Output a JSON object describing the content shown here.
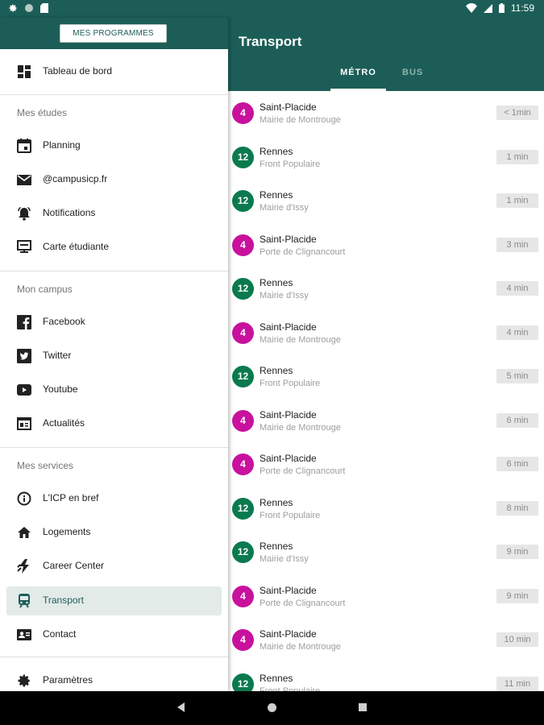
{
  "status_bar": {
    "time": "11:59",
    "icons": [
      "gear-icon",
      "circle-icon",
      "sd-card-icon",
      "wifi-icon",
      "signal-icon",
      "battery-icon"
    ]
  },
  "drawer": {
    "programs_button": "MES PROGRAMMES",
    "dashboard": "Tableau de bord",
    "sections": [
      {
        "title": "Mes études",
        "items": [
          "Planning",
          "@campusicp.fr",
          "Notifications",
          "Carte étudiante"
        ]
      },
      {
        "title": "Mon campus",
        "items": [
          "Facebook",
          "Twitter",
          "Youtube",
          "Actualités"
        ]
      },
      {
        "title": "Mes services",
        "items": [
          "L'ICP en bref",
          "Logements",
          "Career Center",
          "Transport",
          "Contact"
        ]
      }
    ],
    "settings": "Paramètres",
    "active_item": "Transport"
  },
  "main": {
    "title": "Transport",
    "tabs": [
      {
        "label": "MÉTRO",
        "active": true
      },
      {
        "label": "BUS",
        "active": false
      }
    ]
  },
  "colors": {
    "primary": "#1c5e57",
    "line4": "#c8119d",
    "line12": "#0a7a4e"
  },
  "departures": [
    {
      "line": "4",
      "station": "Saint-Placide",
      "direction": "Mairie de Montrouge",
      "time": "< 1min"
    },
    {
      "line": "12",
      "station": "Rennes",
      "direction": "Front Populaire",
      "time": "1 min"
    },
    {
      "line": "12",
      "station": "Rennes",
      "direction": "Mairie d'Issy",
      "time": "1 min"
    },
    {
      "line": "4",
      "station": "Saint-Placide",
      "direction": "Porte de Clignancourt",
      "time": "3 min"
    },
    {
      "line": "12",
      "station": "Rennes",
      "direction": "Mairie d'Issy",
      "time": "4 min"
    },
    {
      "line": "4",
      "station": "Saint-Placide",
      "direction": "Mairie de Montrouge",
      "time": "4 min"
    },
    {
      "line": "12",
      "station": "Rennes",
      "direction": "Front Populaire",
      "time": "5 min"
    },
    {
      "line": "4",
      "station": "Saint-Placide",
      "direction": "Mairie de Montrouge",
      "time": "6 min"
    },
    {
      "line": "4",
      "station": "Saint-Placide",
      "direction": "Porte de Clignancourt",
      "time": "6 min"
    },
    {
      "line": "12",
      "station": "Rennes",
      "direction": "Front Populaire",
      "time": "8 min"
    },
    {
      "line": "12",
      "station": "Rennes",
      "direction": "Mairie d'Issy",
      "time": "9 min"
    },
    {
      "line": "4",
      "station": "Saint-Placide",
      "direction": "Porte de Clignancourt",
      "time": "9 min"
    },
    {
      "line": "4",
      "station": "Saint-Placide",
      "direction": "Mairie de Montrouge",
      "time": "10 min"
    },
    {
      "line": "12",
      "station": "Rennes",
      "direction": "Front Populaire",
      "time": "11 min"
    }
  ]
}
